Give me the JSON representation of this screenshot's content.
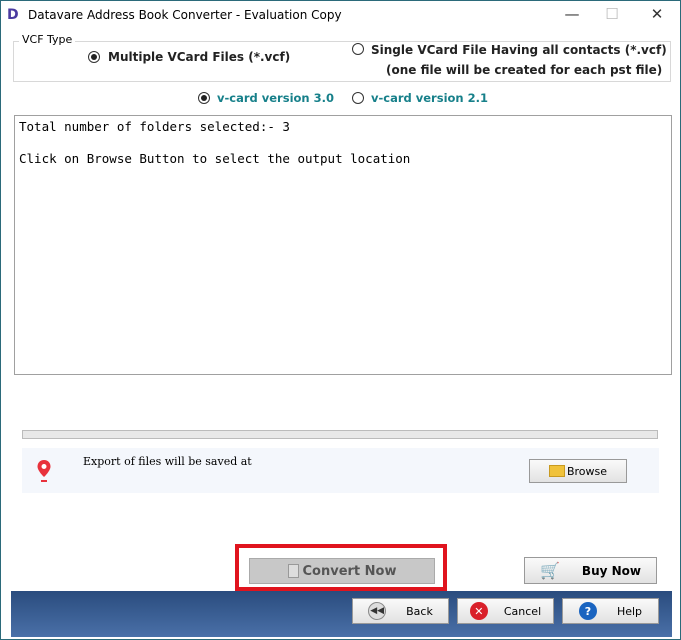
{
  "window": {
    "title": "Datavare Address Book Converter - Evaluation Copy",
    "logo": "D",
    "minimize": "—",
    "maximize": "☐",
    "close": "✕"
  },
  "vcf_type": {
    "label": "VCF Type",
    "options": [
      {
        "label": "Multiple VCard Files (*.vcf)",
        "selected": true
      },
      {
        "label": "Single VCard File Having all contacts (*.vcf)",
        "sublabel": "(one file will be created for each pst file)",
        "selected": false
      }
    ]
  },
  "version": {
    "options": [
      {
        "label": "v-card version 3.0",
        "selected": true
      },
      {
        "label": "v-card version 2.1",
        "selected": false
      }
    ],
    "color": "#17808a"
  },
  "log": {
    "lines": [
      "Total number of folders selected:- 3",
      "",
      "Click on Browse Button to select the output location"
    ]
  },
  "progress": 0,
  "export": {
    "label": "Export of files will be saved at",
    "browse": "Browse"
  },
  "buttons": {
    "convert": "Convert Now",
    "buy": "Buy Now",
    "back": "Back",
    "cancel": "Cancel",
    "help": "Help"
  },
  "colors": {
    "highlight": "#e0141e",
    "footer": "#3a5f95"
  }
}
